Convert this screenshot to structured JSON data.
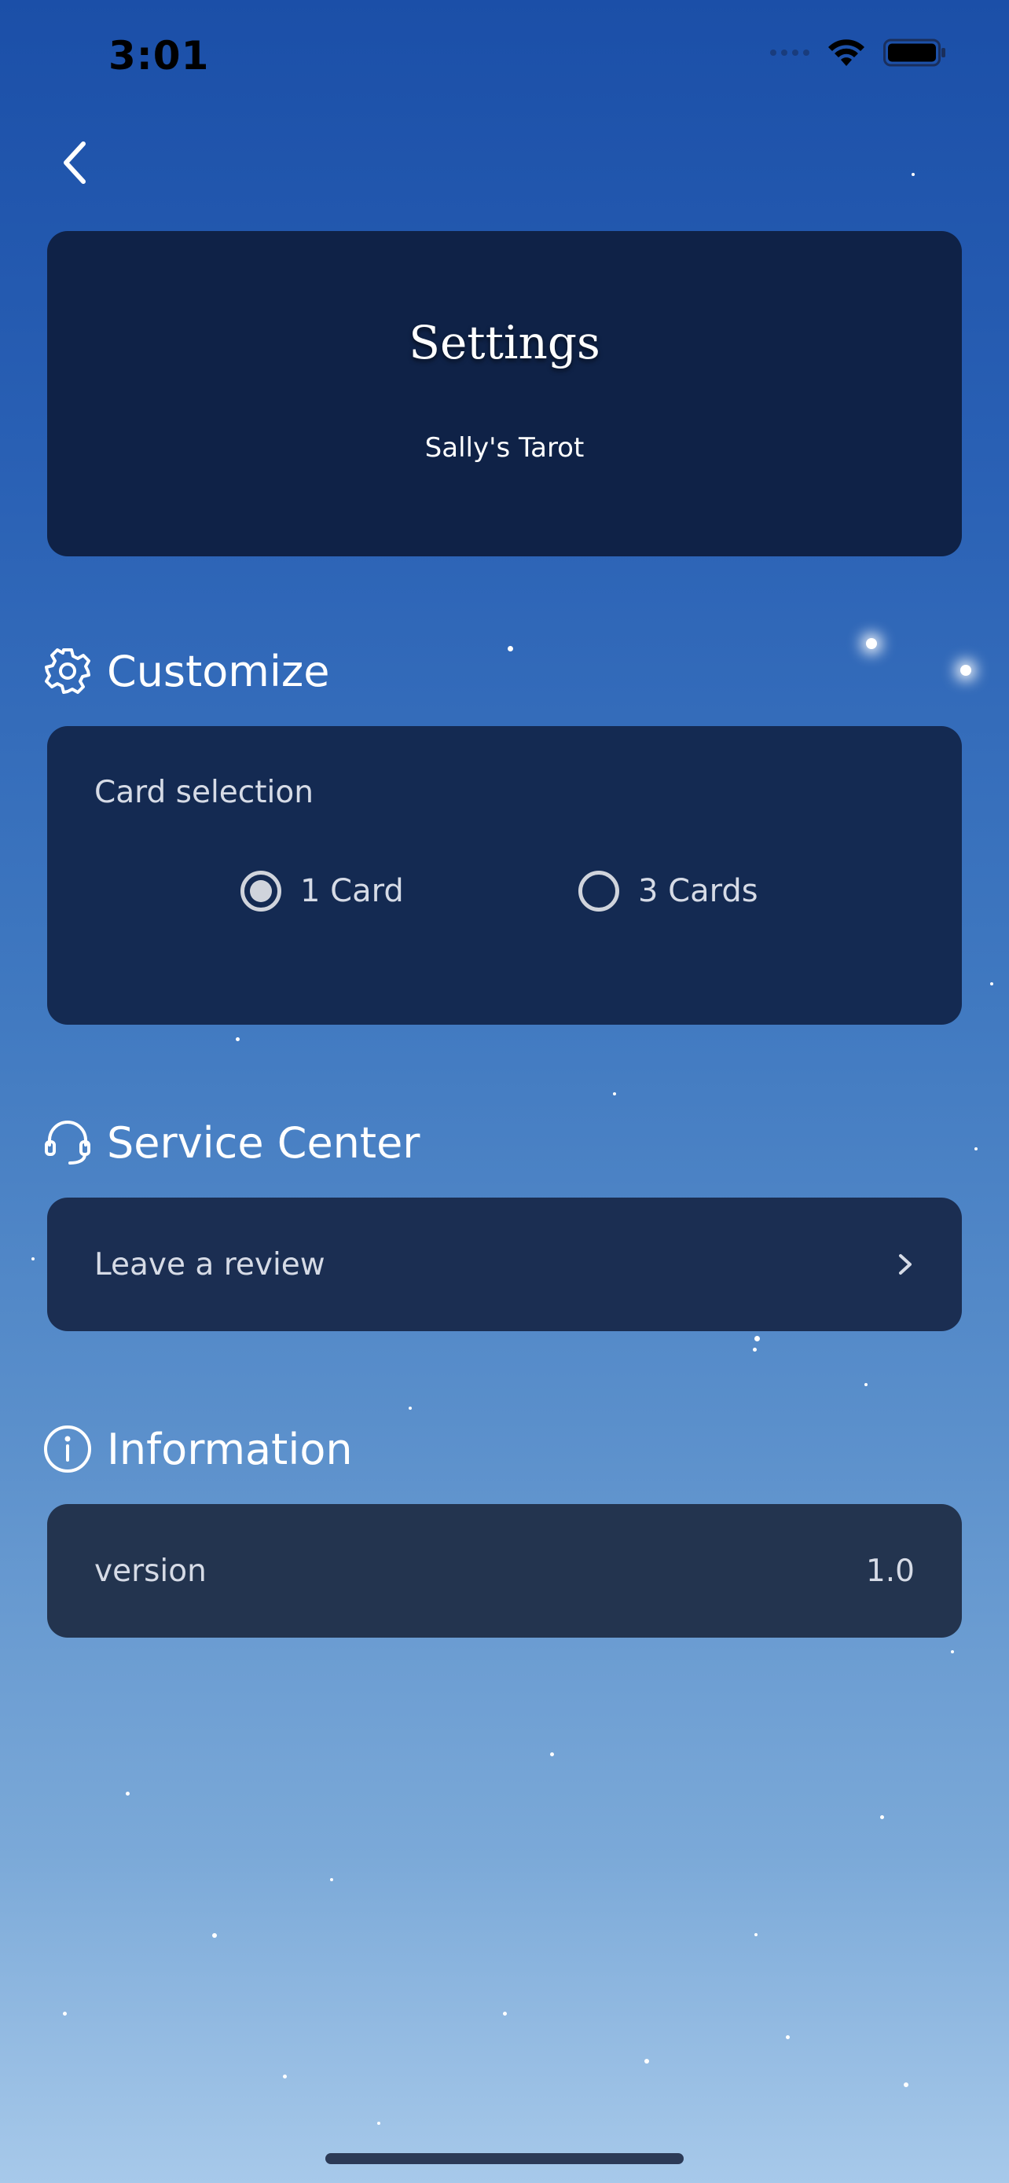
{
  "status_bar": {
    "time": "3:01"
  },
  "header": {
    "title": "Settings",
    "subtitle": "Sally's Tarot"
  },
  "sections": {
    "customize": {
      "title": "Customize",
      "card_selection_label": "Card selection",
      "options": [
        {
          "label": "1 Card",
          "selected": true
        },
        {
          "label": "3 Cards",
          "selected": false
        }
      ]
    },
    "service_center": {
      "title": "Service Center",
      "review_label": "Leave a review"
    },
    "information": {
      "title": "Information",
      "version_label": "version",
      "version_value": "1.0"
    }
  },
  "icons": {
    "back": "chevron-left-icon",
    "customize": "gear-icon",
    "service_center": "headset-icon",
    "information": "info-icon",
    "review_chevron": "chevron-right-icon"
  }
}
